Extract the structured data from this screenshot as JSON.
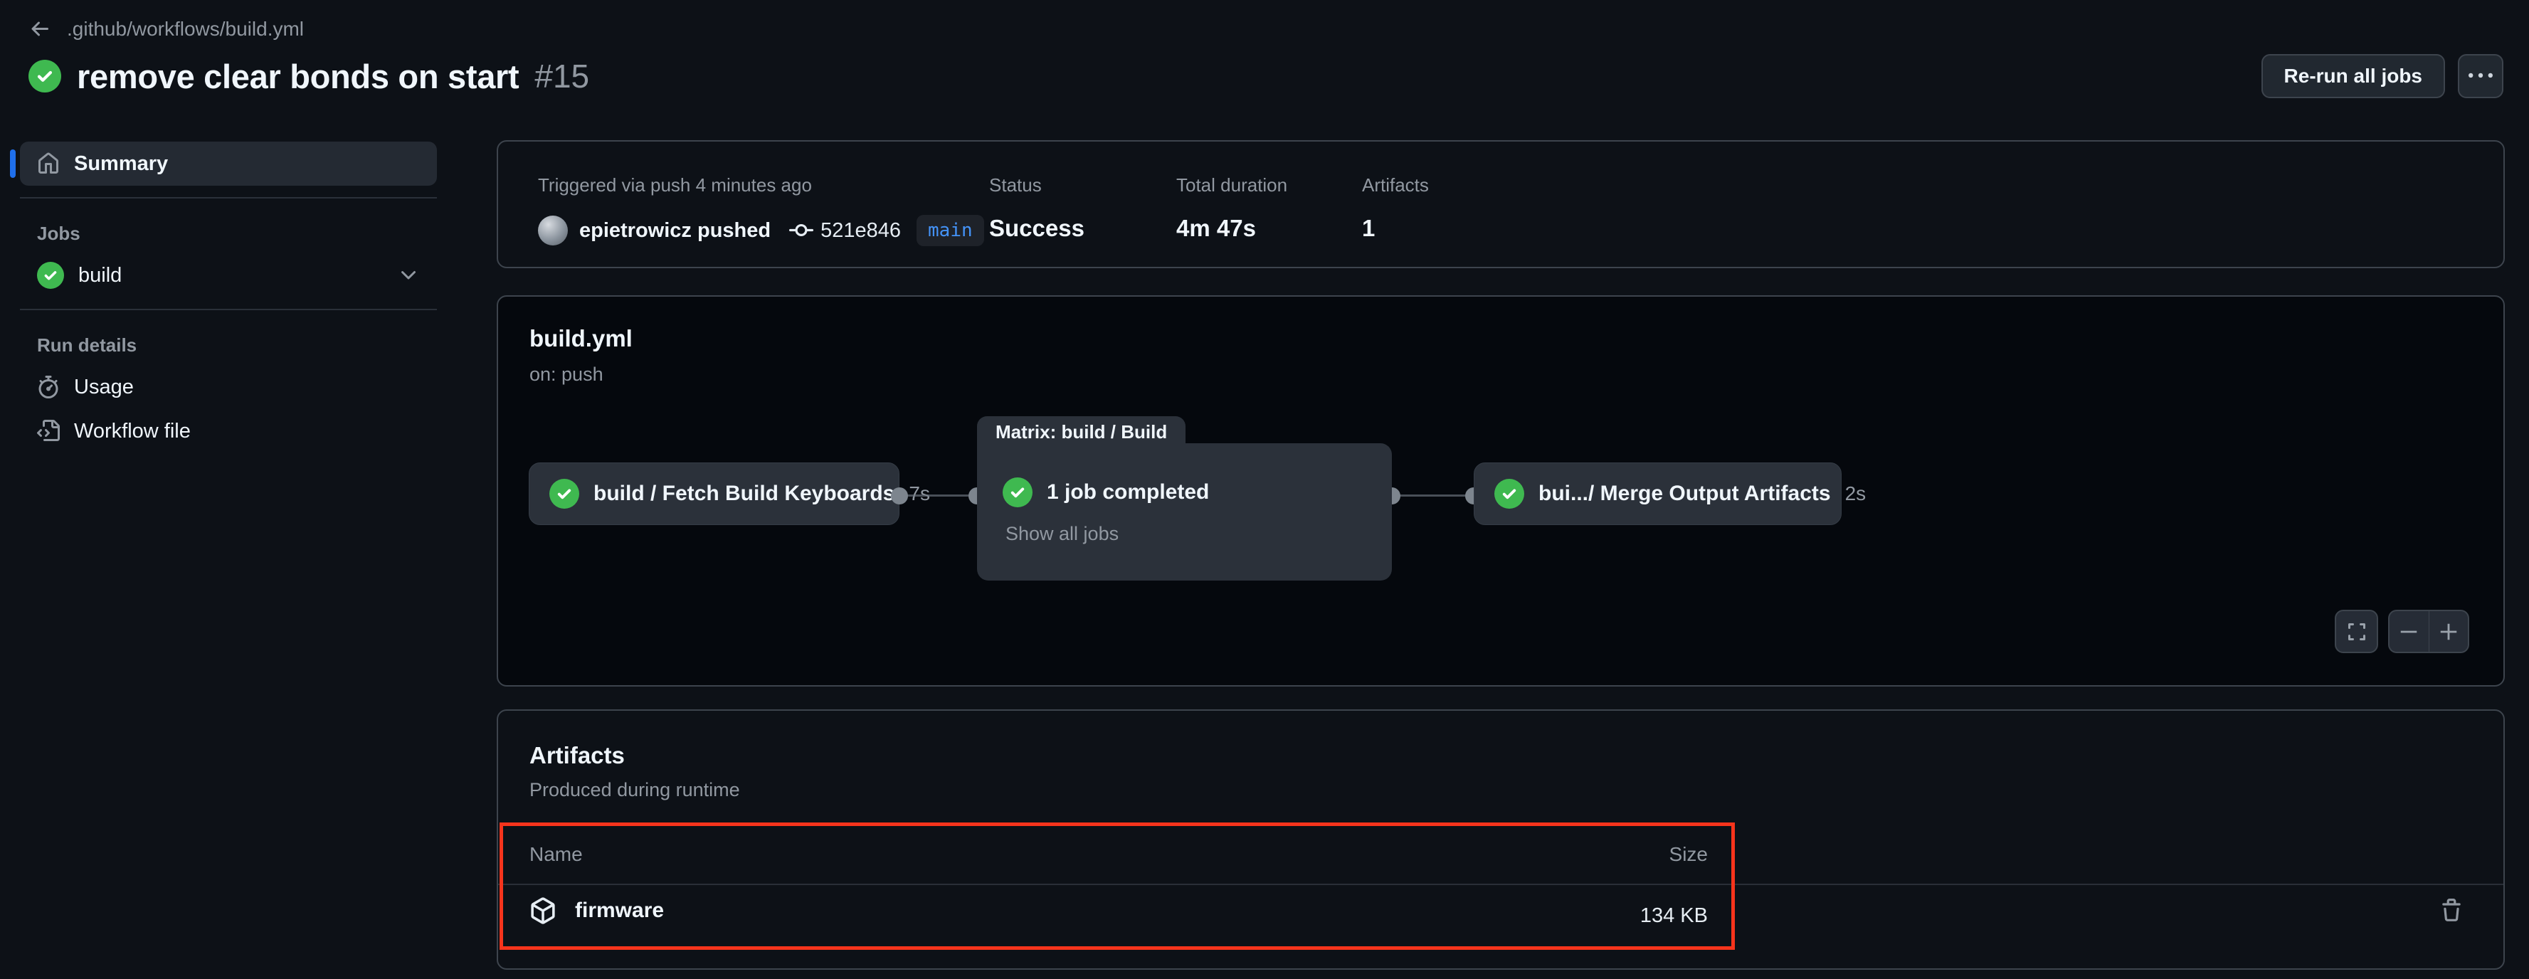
{
  "colors": {
    "page_bg": "#0d1117",
    "panel_border": "#3d444d",
    "graph_canvas_bg": "#05080d",
    "node_bg": "#2b313a",
    "text_primary": "#f0f6fc",
    "text_muted": "#9198a1",
    "success_green": "#3fb950",
    "accent_blue": "#4493f8",
    "selected_bar_blue": "#1f6feb",
    "button_bg": "#212830",
    "annotation_red": "#f6341c"
  },
  "topbar": {
    "breadcrumb": ".github/workflows/build.yml",
    "title": "remove clear bonds on start",
    "run_number": "#15",
    "rerun_button_label": "Re-run all jobs"
  },
  "sidebar": {
    "summary_label": "Summary",
    "jobs_header": "Jobs",
    "job_build_label": "build",
    "run_details_header": "Run details",
    "usage_label": "Usage",
    "workflow_file_label": "Workflow file"
  },
  "run_header": {
    "triggered_label": "Triggered via push 4 minutes ago",
    "pushed_text": "epietrowicz pushed",
    "commit_sha": "521e846",
    "branch": "main",
    "status_label": "Status",
    "status_value": "Success",
    "duration_label": "Total duration",
    "duration_value": "4m 47s",
    "artifacts_label": "Artifacts",
    "artifacts_count": "1"
  },
  "graph": {
    "workflow_file": "build.yml",
    "trigger": "on: push",
    "nodes": [
      {
        "label": "build / Fetch Build Keyboards",
        "duration": "7s"
      },
      {
        "label": "bui.../ Merge Output Artifacts",
        "duration": "2s"
      }
    ],
    "matrix": {
      "tab_label": "Matrix: build / Build",
      "summary": "1 job completed",
      "show_all_label": "Show all jobs"
    }
  },
  "artifacts": {
    "title": "Artifacts",
    "subtitle": "Produced during runtime",
    "name_header": "Name",
    "size_header": "Size",
    "rows": [
      {
        "name": "firmware",
        "size": "134 KB"
      }
    ]
  }
}
